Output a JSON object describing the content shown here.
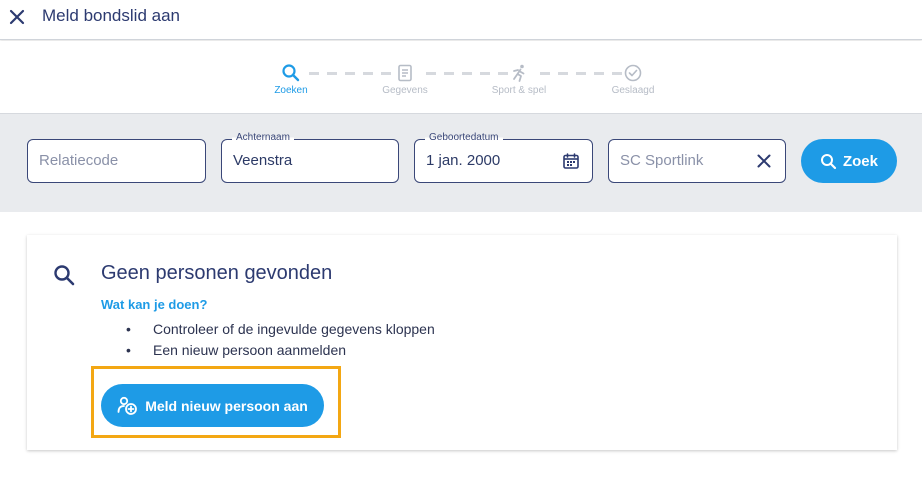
{
  "header": {
    "title": "Meld bondslid aan",
    "close_icon": "close-icon"
  },
  "stepper": {
    "steps": [
      {
        "label": "Zoeken",
        "icon": "search-icon",
        "active": true
      },
      {
        "label": "Gegevens",
        "icon": "clipboard-icon",
        "active": false
      },
      {
        "label": "Sport & spel",
        "icon": "runner-icon",
        "active": false
      },
      {
        "label": "Geslaagd",
        "icon": "check-circle-icon",
        "active": false
      }
    ]
  },
  "search": {
    "relatiecode": {
      "placeholder": "Relatiecode",
      "value": ""
    },
    "achternaam": {
      "label": "Achternaam",
      "value": "Veenstra"
    },
    "geboortedatum": {
      "label": "Geboortedatum",
      "value": "1 jan. 2000",
      "icon": "calendar-icon"
    },
    "club": {
      "placeholder": "SC Sportlink",
      "value": "",
      "icon": "clear-icon"
    },
    "submit_label": "Zoek"
  },
  "result": {
    "title": "Geen personen gevonden",
    "subtitle": "Wat kan je doen?",
    "suggestions": [
      "Controleer of de ingevulde gegevens kloppen",
      "Een nieuw persoon aanmelden"
    ],
    "add_button_label": "Meld nieuw persoon aan"
  },
  "colors": {
    "accent": "#1e9be6",
    "primary_text": "#2c3a70",
    "highlight": "#f3a713"
  }
}
